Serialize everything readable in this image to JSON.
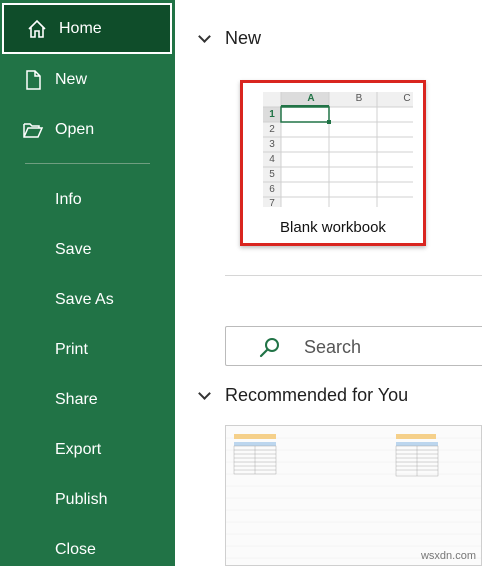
{
  "sidebar": {
    "items": [
      {
        "label": "Home",
        "icon": "home-icon"
      },
      {
        "label": "New",
        "icon": "new-document-icon"
      },
      {
        "label": "Open",
        "icon": "folder-open-icon"
      },
      {
        "label": "Info"
      },
      {
        "label": "Save"
      },
      {
        "label": "Save As"
      },
      {
        "label": "Print"
      },
      {
        "label": "Share"
      },
      {
        "label": "Export"
      },
      {
        "label": "Publish"
      },
      {
        "label": "Close"
      }
    ]
  },
  "main": {
    "new_section": {
      "heading": "New",
      "template": {
        "caption": "Blank workbook",
        "columns": [
          "A",
          "B",
          "C"
        ],
        "rows": [
          "1",
          "2",
          "3",
          "4",
          "5",
          "6",
          "7"
        ]
      }
    },
    "search": {
      "placeholder": "Search"
    },
    "recommended": {
      "heading": "Recommended for You"
    }
  },
  "watermark": "wsxdn.com",
  "colors": {
    "sidebar": "#217346",
    "active": "#0f4d2a",
    "highlight": "#d9251f",
    "cell_select": "#217346"
  }
}
